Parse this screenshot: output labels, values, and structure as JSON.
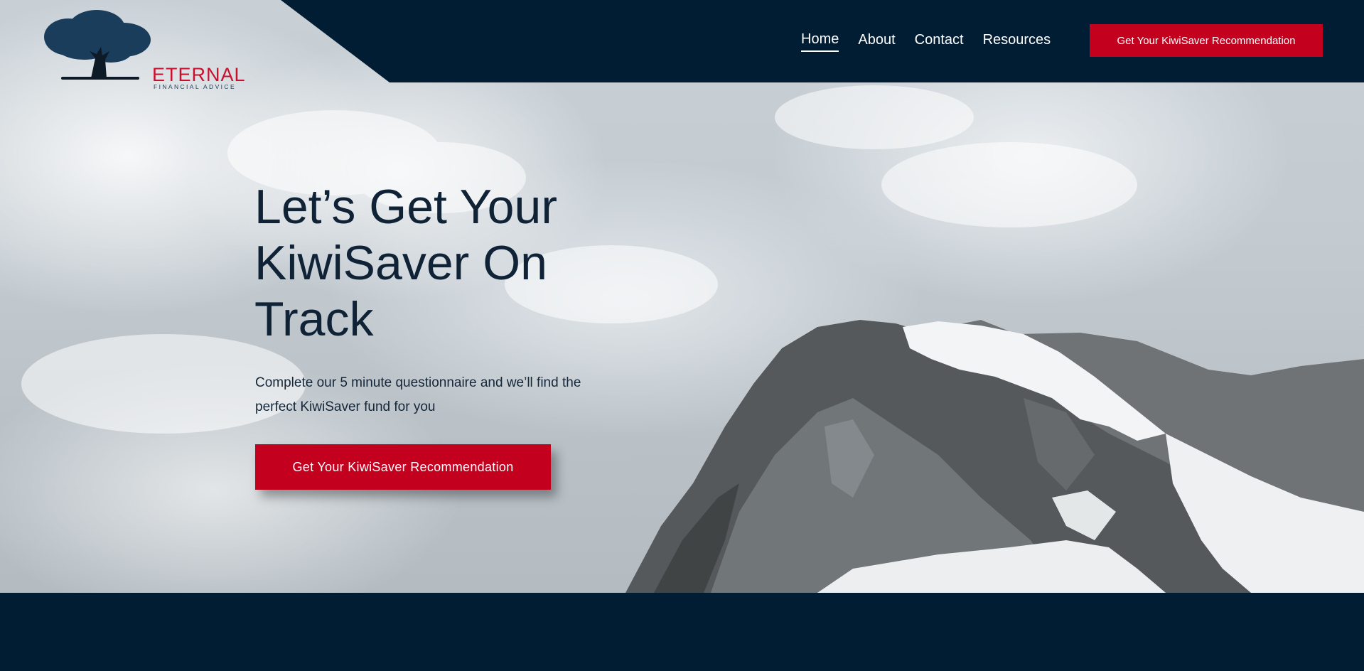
{
  "brand": {
    "name": "ETERNAL",
    "tagline": "FINANCIAL ADVICE",
    "logo_icon": "tree-icon",
    "colors": {
      "navy": "#001d33",
      "accent_red": "#c4001f",
      "heading": "#0f2236"
    }
  },
  "nav": {
    "items": [
      {
        "label": "Home",
        "active": true
      },
      {
        "label": "About",
        "active": false
      },
      {
        "label": "Contact",
        "active": false
      },
      {
        "label": "Resources",
        "active": false
      }
    ],
    "cta_label": "Get Your KiwiSaver Recommendation"
  },
  "hero": {
    "title_lines": [
      "Let’s Get Your",
      "KiwiSaver On",
      "Track"
    ],
    "subtitle_lines": [
      "Complete our 5 minute questionnaire and we’ll find the",
      "perfect KiwiSaver fund for you"
    ],
    "cta_label": "Get Your KiwiSaver Recommendation",
    "background": "snowy-mountain-peak-under-cloudy-sky"
  }
}
